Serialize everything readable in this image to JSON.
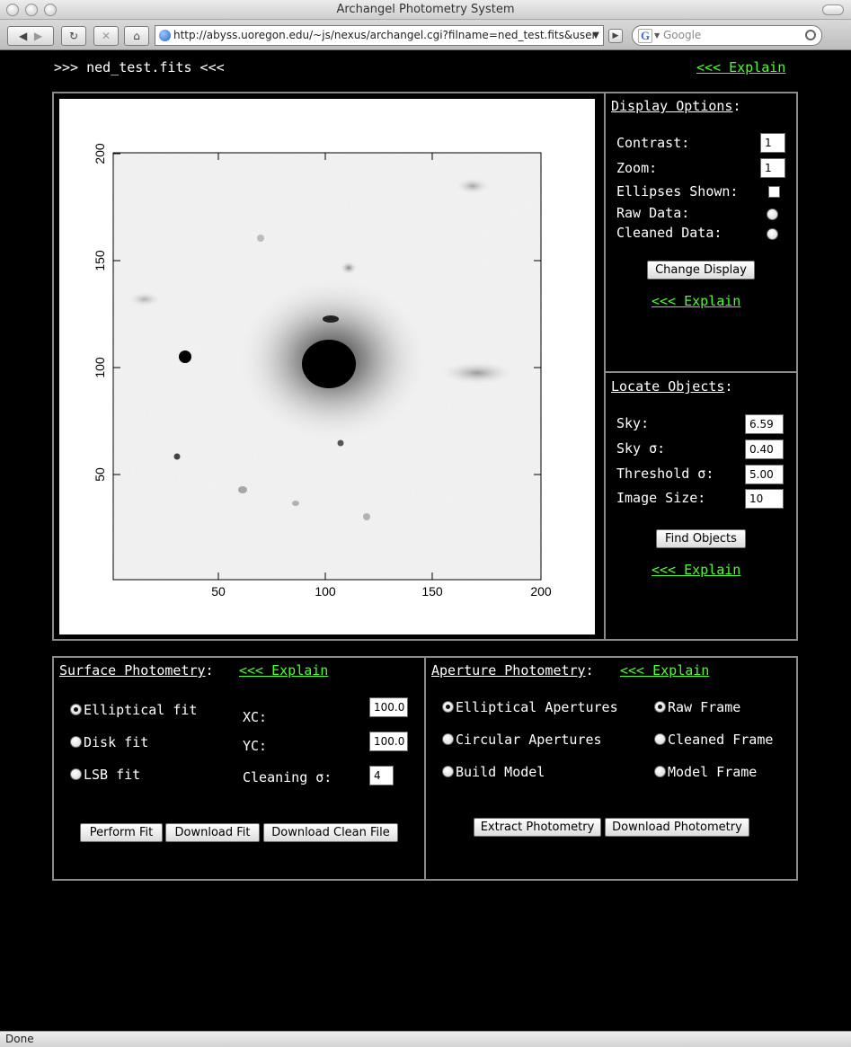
{
  "window": {
    "title": "Archangel Photometry System"
  },
  "toolbar": {
    "back_icon": "back-arrow-icon",
    "forward_icon": "forward-arrow-icon",
    "url": "http://abyss.uoregon.edu/~js/nexus/archangel.cgi?filname=ned_test.fits&user",
    "search_placeholder": "Google"
  },
  "header": {
    "filename": ">>> ned_test.fits <<<",
    "explain": "<<< Explain"
  },
  "plot": {
    "x_ticks": [
      "50",
      "100",
      "150",
      "200"
    ],
    "y_ticks": [
      "50",
      "100",
      "150",
      "200"
    ]
  },
  "display_options": {
    "title": "Display Options",
    "colon": ":",
    "contrast_label": "Contrast:",
    "contrast_value": "1",
    "zoom_label": "Zoom:",
    "zoom_value": "1",
    "ellipses_label": "Ellipses Shown:",
    "raw_label": "Raw Data:",
    "cleaned_label": "Cleaned Data:",
    "button": "Change Display",
    "explain": "<<< Explain"
  },
  "locate_objects": {
    "title": "Locate Objects",
    "colon": ":",
    "sky_label": "Sky:",
    "sky_value": "6.59",
    "sky_sigma_label": "Sky σ:",
    "sky_sigma_value": "0.40",
    "threshold_label": "Threshold σ:",
    "threshold_value": "5.00",
    "image_size_label": "Image Size:",
    "image_size_value": "10",
    "button": "Find Objects",
    "explain": "<<< Explain"
  },
  "surface_photometry": {
    "title": "Surface Photometry",
    "colon": ":",
    "explain": "<<< Explain",
    "elliptical": "Elliptical fit",
    "disk": "Disk fit",
    "lsb": "LSB fit",
    "xc_label": "XC:",
    "xc_value": "100.0",
    "yc_label": "YC:",
    "yc_value": "100.0",
    "cleaning_label": "Cleaning σ:",
    "cleaning_value": "4",
    "perform_fit": "Perform Fit",
    "download_fit": "Download Fit",
    "download_clean": "Download Clean File"
  },
  "aperture_photometry": {
    "title": "Aperture Photometry",
    "colon": ":",
    "explain": "<<< Explain",
    "elliptical": "Elliptical Apertures",
    "circular": "Circular Apertures",
    "build": "Build Model",
    "raw": "Raw Frame",
    "cleaned": "Cleaned Frame",
    "model": "Model Frame",
    "extract": "Extract Photometry",
    "download": "Download Photometry"
  },
  "status": {
    "text": "Done"
  }
}
